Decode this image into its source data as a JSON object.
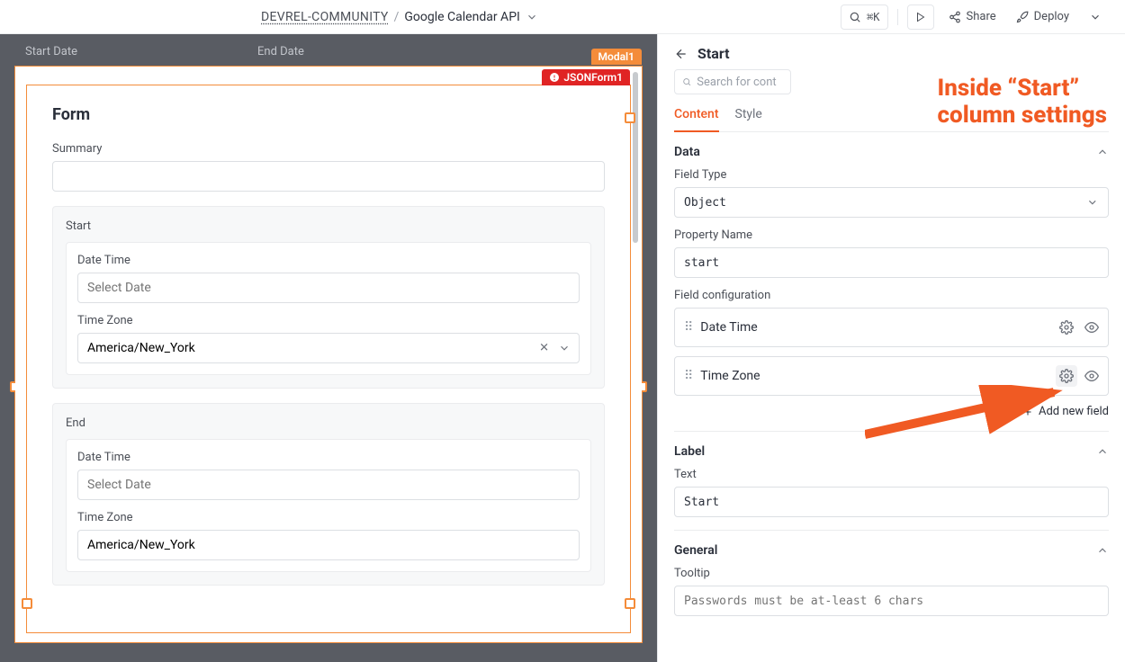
{
  "topbar": {
    "org": "DEVREL-COMMUNITY",
    "separator": "/",
    "project": "Google Calendar API",
    "search_shortcut": "⌘K",
    "share_label": "Share",
    "deploy_label": "Deploy"
  },
  "canvas": {
    "col_start_label": "Start Date",
    "col_end_label": "End Date",
    "modal_tag": "Modal1",
    "json_tag": "JSONForm1"
  },
  "form": {
    "title": "Form",
    "summary_label": "Summary",
    "summary_value": "",
    "start": {
      "title": "Start",
      "datetime_label": "Date Time",
      "datetime_placeholder": "Select Date",
      "datetime_value": "",
      "timezone_label": "Time Zone",
      "timezone_value": "America/New_York"
    },
    "end": {
      "title": "End",
      "datetime_label": "Date Time",
      "datetime_placeholder": "Select Date",
      "datetime_value": "",
      "timezone_label": "Time Zone",
      "timezone_value": "America/New_York"
    }
  },
  "rpanel": {
    "title": "Start",
    "search_placeholder": "Search for cont",
    "tabs": {
      "content": "Content",
      "style": "Style"
    },
    "data": {
      "section_title": "Data",
      "field_type_label": "Field Type",
      "field_type_value": "Object",
      "property_name_label": "Property Name",
      "property_name_value": "start",
      "field_config_label": "Field configuration",
      "fields": [
        {
          "label": "Date Time"
        },
        {
          "label": "Time Zone"
        }
      ],
      "add_field_label": "Add new field"
    },
    "label_section": {
      "section_title": "Label",
      "text_label": "Text",
      "text_value": "Start"
    },
    "general": {
      "section_title": "General",
      "tooltip_label": "Tooltip",
      "tooltip_placeholder": "Passwords must be at-least 6 chars"
    }
  },
  "annotation": {
    "line1": "Inside “Start”",
    "line2": "column settings"
  }
}
